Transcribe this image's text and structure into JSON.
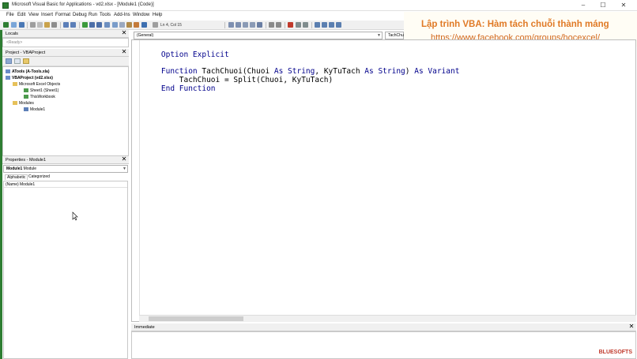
{
  "window": {
    "title": "Microsoft Visual Basic for Applications - vd2.xlsx - [Module1 (Code)]",
    "minimize_glyph": "–",
    "maximize_glyph": "☐",
    "close_glyph": "✕"
  },
  "menu": [
    "File",
    "Edit",
    "View",
    "Insert",
    "Format",
    "Debug",
    "Run",
    "Tools",
    "Add-Ins",
    "Window",
    "Help"
  ],
  "toolbar": {
    "position_text": "Ln 4, Col 15"
  },
  "overlay": {
    "title": "Lập trình VBA: Hàm tách chuỗi thành máng",
    "link": "https://www.facebook.com/groups/hocexcel/"
  },
  "locals": {
    "title": "Locals",
    "status": "<Ready>",
    "close_glyph": "✕"
  },
  "project": {
    "title": "Project - VBAProject",
    "close_glyph": "✕",
    "items": [
      {
        "label": "ATools (A-Tools.xla)",
        "bold": true
      },
      {
        "label": "VBAProject (vd2.xlsx)",
        "bold": true
      },
      {
        "label": "Microsoft Excel Objects",
        "bold": false
      },
      {
        "label": "Sheet1 (Sheet1)",
        "bold": false
      },
      {
        "label": "ThisWorkbook",
        "bold": false
      },
      {
        "label": "Modules",
        "bold": false
      },
      {
        "label": "Module1",
        "bold": false
      }
    ]
  },
  "properties": {
    "title": "Properties - Module1",
    "close_glyph": "✕",
    "object_name": "Module1",
    "object_type": "Module",
    "tabs": [
      "Alphabetic",
      "Categorized"
    ],
    "row_name": "(Name)",
    "row_value": "Module1"
  },
  "code": {
    "object_combo": "(General)",
    "proc_combo": "TachChu",
    "lines": [
      {
        "kw": "Option Explicit",
        "rest": ""
      },
      {
        "kw": "",
        "rest": ""
      },
      {
        "kw": "Function",
        "rest": " TachChuoi(Chuoi As String, KyTuTach As String) As Variant"
      },
      {
        "kw": "",
        "rest": "    TachChuoi = Split(Chuoi, KyTuTach)"
      },
      {
        "kw": "End Function",
        "rest": ""
      }
    ]
  },
  "immediate": {
    "title": "Immediate",
    "close_glyph": "✕"
  },
  "watermark": {
    "text": "BLUESOFTS"
  },
  "colors": {
    "keyword": "#00008b",
    "overlay_text": "#e07a26"
  }
}
